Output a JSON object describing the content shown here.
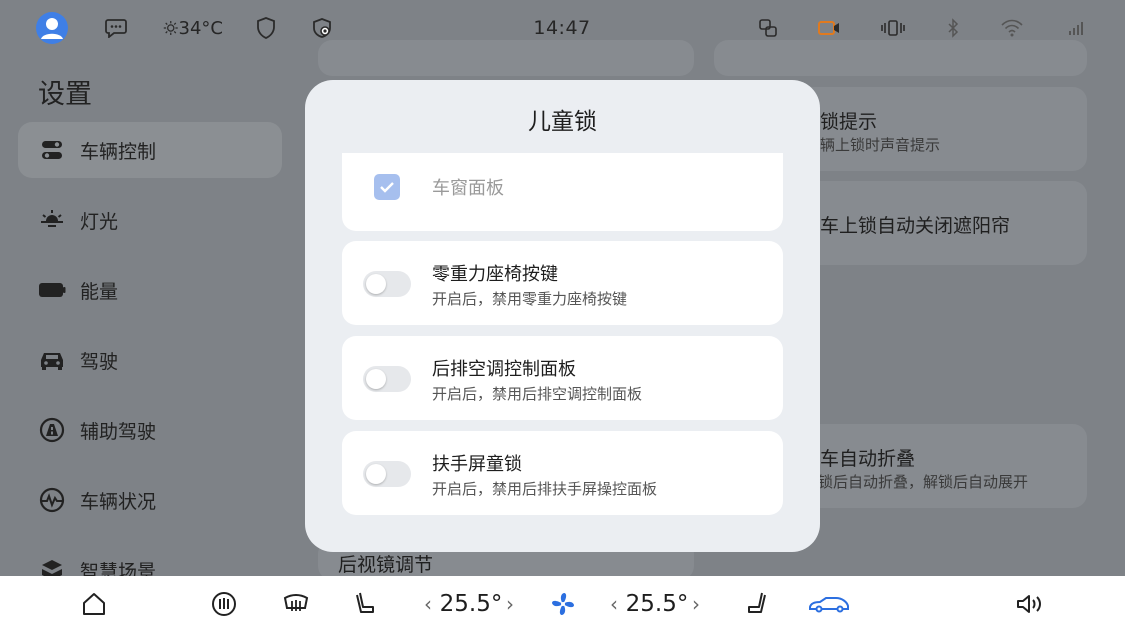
{
  "status_bar": {
    "temperature": "34°C",
    "time": "14:47"
  },
  "sidebar": {
    "title": "设置",
    "items": [
      {
        "label": "车辆控制",
        "icon": "vehicle-control-icon",
        "active": true
      },
      {
        "label": "灯光",
        "icon": "light-icon",
        "active": false
      },
      {
        "label": "能量",
        "icon": "battery-icon",
        "active": false
      },
      {
        "label": "驾驶",
        "icon": "car-icon",
        "active": false
      },
      {
        "label": "辅助驾驶",
        "icon": "assist-driving-icon",
        "active": false
      },
      {
        "label": "车辆状况",
        "icon": "vehicle-status-icon",
        "active": false
      },
      {
        "label": "智慧场景",
        "icon": "smart-scene-icon",
        "active": false
      }
    ]
  },
  "background": {
    "lock_hint_title": "锁提示",
    "lock_hint_sub": "辆上锁时声音提示",
    "sunshade_title": "车上锁自动关闭遮阳帘",
    "fold_title": "车自动折叠",
    "fold_sub": "锁后自动折叠，解锁后自动展开",
    "mirror_title": "后视镜调节"
  },
  "modal": {
    "title": "儿童锁",
    "checkbox_option": {
      "label": "车窗面板",
      "checked": true
    },
    "options": [
      {
        "title": "零重力座椅按键",
        "desc": "开启后，禁用零重力座椅按键",
        "on": false
      },
      {
        "title": "后排空调控制面板",
        "desc": "开启后，禁用后排空调控制面板",
        "on": false
      },
      {
        "title": "扶手屏童锁",
        "desc": "开启后，禁用后排扶手屏操控面板",
        "on": false
      }
    ]
  },
  "dock": {
    "left_temp": "25.5°",
    "right_temp": "25.5°",
    "chevron_left": "‹",
    "chevron_right": "›"
  },
  "colors": {
    "accent": "#3f7fe6",
    "fan_blue": "#2c6fe0",
    "checkbox": "#a6bfee"
  }
}
